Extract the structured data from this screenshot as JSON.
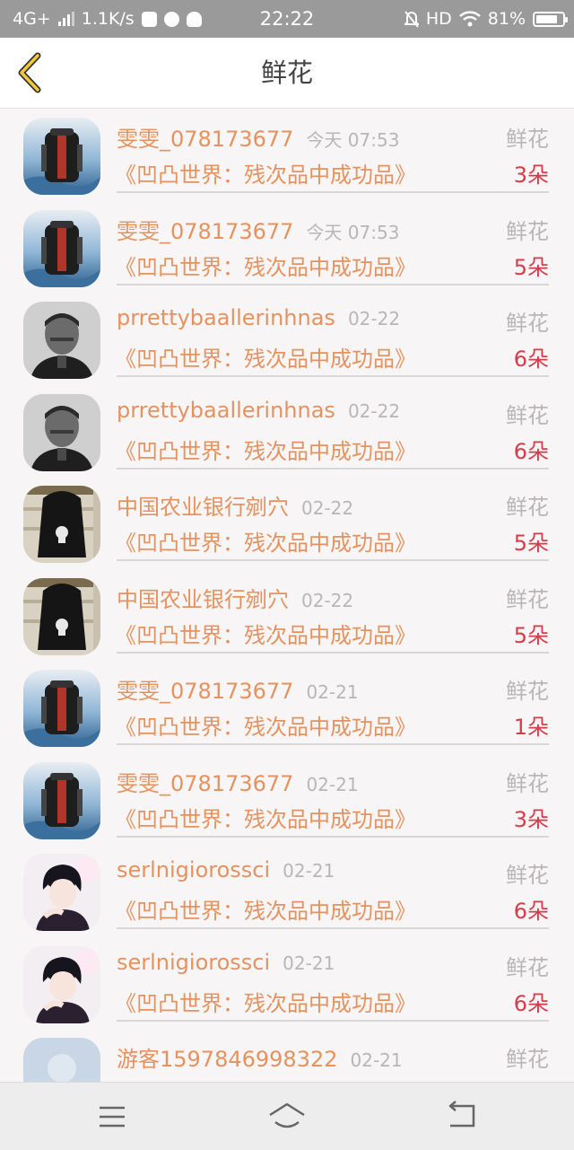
{
  "status_bar": {
    "network": "4G+",
    "speed": "1.1K/s",
    "time": "22:22",
    "hd": "HD",
    "battery": "81%",
    "battery_level": 0.81
  },
  "header": {
    "title": "鲜花",
    "back_icon": "chevron-left-icon"
  },
  "colors": {
    "accent_name": "#e6925f",
    "count": "#d63c4a",
    "muted": "#b9b6b7"
  },
  "rows": [
    {
      "avatar": "backpack",
      "name": "雯雯_078173677",
      "time": "今天 07:53",
      "gift": "鲜花",
      "book": "《凹凸世界：残次品中成功品》",
      "count": "3朵"
    },
    {
      "avatar": "backpack",
      "name": "雯雯_078173677",
      "time": "今天 07:53",
      "gift": "鲜花",
      "book": "《凹凸世界：残次品中成功品》",
      "count": "5朵"
    },
    {
      "avatar": "man",
      "name": "prrettybaallerinhnas",
      "time": "02-22",
      "gift": "鲜花",
      "book": "《凹凸世界：残次品中成功品》",
      "count": "6朵"
    },
    {
      "avatar": "man",
      "name": "prrettybaallerinhnas",
      "time": "02-22",
      "gift": "鲜花",
      "book": "《凹凸世界：残次品中成功品》",
      "count": "6朵"
    },
    {
      "avatar": "bag",
      "name": "中国农业银行剜穴",
      "time": "02-22",
      "gift": "鲜花",
      "book": "《凹凸世界：残次品中成功品》",
      "count": "5朵"
    },
    {
      "avatar": "bag",
      "name": "中国农业银行剜穴",
      "time": "02-22",
      "gift": "鲜花",
      "book": "《凹凸世界：残次品中成功品》",
      "count": "5朵"
    },
    {
      "avatar": "backpack",
      "name": "雯雯_078173677",
      "time": "02-21",
      "gift": "鲜花",
      "book": "《凹凸世界：残次品中成功品》",
      "count": "1朵"
    },
    {
      "avatar": "backpack",
      "name": "雯雯_078173677",
      "time": "02-21",
      "gift": "鲜花",
      "book": "《凹凸世界：残次品中成功品》",
      "count": "3朵"
    },
    {
      "avatar": "anime",
      "name": "serlnigiorossci",
      "time": "02-21",
      "gift": "鲜花",
      "book": "《凹凸世界：残次品中成功品》",
      "count": "6朵"
    },
    {
      "avatar": "anime",
      "name": "serlnigiorossci",
      "time": "02-21",
      "gift": "鲜花",
      "book": "《凹凸世界：残次品中成功品》",
      "count": "6朵"
    },
    {
      "avatar": "guest",
      "name": "游客1597846998322",
      "time": "02-21",
      "gift": "鲜花",
      "book": "",
      "count": ""
    }
  ],
  "bottom_nav": {
    "menu_icon": "menu-icon",
    "home_icon": "home-icon",
    "back_icon": "return-icon"
  }
}
